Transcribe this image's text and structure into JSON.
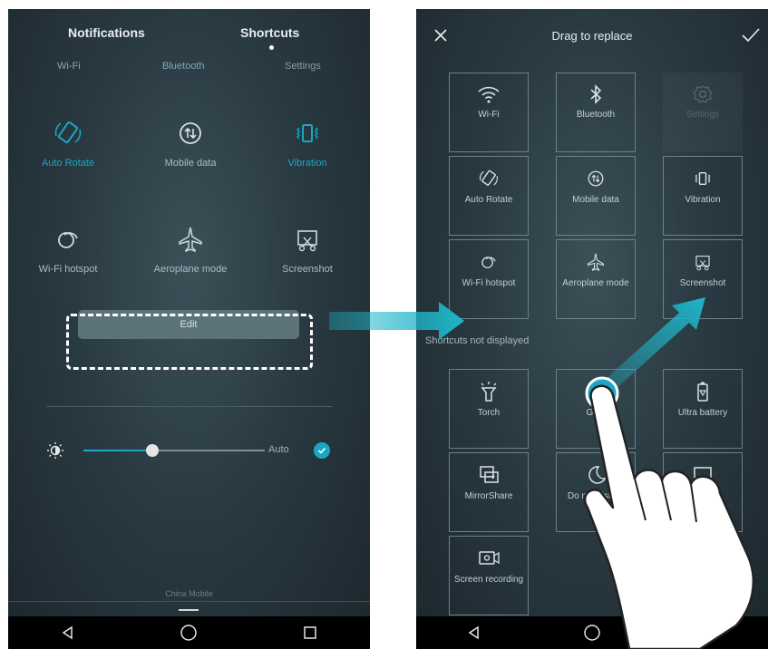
{
  "left_panel": {
    "tabs": {
      "notifications": "Notifications",
      "shortcuts": "Shortcuts"
    },
    "top_row": {
      "wifi": "Wi-Fi",
      "bluetooth": "Bluetooth",
      "settings": "Settings"
    },
    "shortcuts": [
      {
        "label": "Auto Rotate",
        "icon": "auto-rotate-icon",
        "active": true
      },
      {
        "label": "Mobile data",
        "icon": "mobile-data-icon",
        "active": false
      },
      {
        "label": "Vibration",
        "icon": "vibration-icon",
        "active": true
      },
      {
        "label": "Wi-Fi hotspot",
        "icon": "hotspot-icon",
        "active": false
      },
      {
        "label": "Aeroplane mode",
        "icon": "airplane-icon",
        "active": false
      },
      {
        "label": "Screenshot",
        "icon": "screenshot-icon",
        "active": false
      }
    ],
    "edit_label": "Edit",
    "brightness": {
      "level": 0.38,
      "auto_label": "Auto",
      "auto_checked": true
    },
    "carrier": "China Mobile"
  },
  "right_panel": {
    "title": "Drag to replace",
    "displayed": [
      {
        "label": "Wi-Fi",
        "icon": "wifi-icon",
        "dim": false
      },
      {
        "label": "Bluetooth",
        "icon": "bluetooth-icon",
        "dim": false
      },
      {
        "label": "Settings",
        "icon": "settings-icon",
        "dim": true
      },
      {
        "label": "Auto Rotate",
        "icon": "auto-rotate-icon",
        "dim": false
      },
      {
        "label": "Mobile data",
        "icon": "mobile-data-icon",
        "dim": false
      },
      {
        "label": "Vibration",
        "icon": "vibration-icon",
        "dim": false
      },
      {
        "label": "Wi-Fi hotspot",
        "icon": "hotspot-icon",
        "dim": false
      },
      {
        "label": "Aeroplane mode",
        "icon": "airplane-icon",
        "dim": false
      },
      {
        "label": "Screenshot",
        "icon": "screenshot-icon",
        "dim": false
      }
    ],
    "section_label": "Shortcuts not displayed",
    "not_displayed": [
      {
        "label": "Torch",
        "icon": "torch-icon"
      },
      {
        "label": "GPS",
        "icon": "gps-icon"
      },
      {
        "label": "Ultra battery",
        "icon": "battery-icon"
      },
      {
        "label": "MirrorShare",
        "icon": "mirrorshare-icon"
      },
      {
        "label": "Do not disturb",
        "icon": "moon-icon"
      },
      {
        "label": "",
        "icon": "partial-icon"
      },
      {
        "label": "Screen recording",
        "icon": "screen-recording-icon"
      }
    ]
  },
  "colors": {
    "accent": "#1aa7c6",
    "arrow": "#1fb5c9",
    "panel_bg": "#2a3a42"
  }
}
